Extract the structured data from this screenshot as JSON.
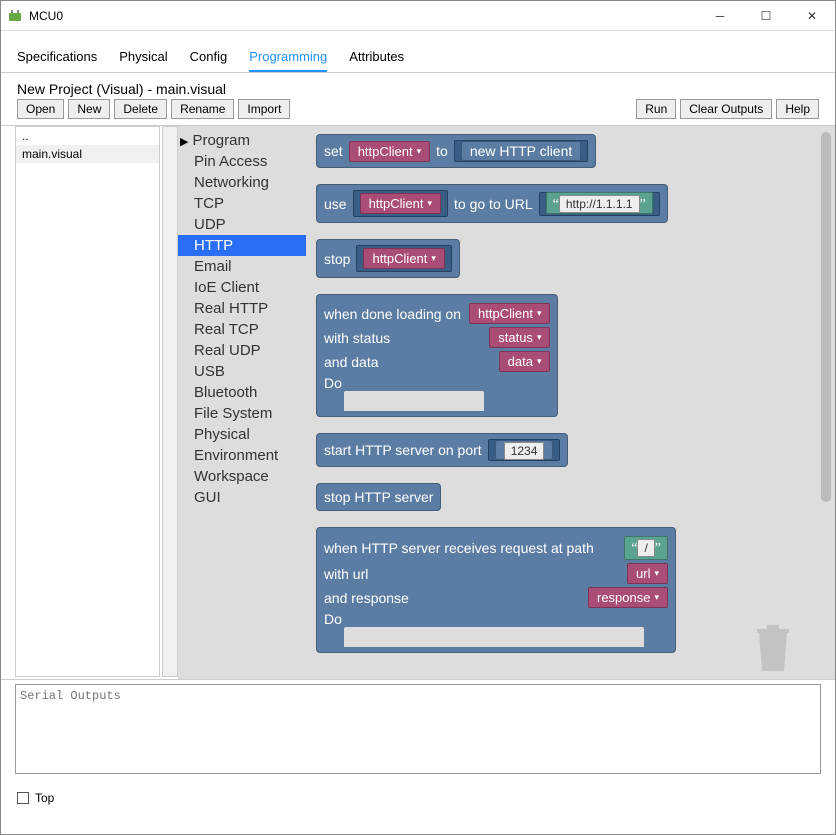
{
  "window": {
    "title": "MCU0"
  },
  "tabs": [
    "Specifications",
    "Physical",
    "Config",
    "Programming",
    "Attributes"
  ],
  "active_tab": "Programming",
  "project_title": "New Project (Visual) - main.visual",
  "toolbar_left": [
    "Open",
    "New",
    "Delete",
    "Rename",
    "Import"
  ],
  "toolbar_right": [
    "Run",
    "Clear Outputs",
    "Help"
  ],
  "filelist": [
    "..",
    "main.visual"
  ],
  "categories": [
    "Program",
    "Pin Access",
    "Networking",
    "TCP",
    "UDP",
    "HTTP",
    "Email",
    "IoE Client",
    "Real HTTP",
    "Real TCP",
    "Real UDP",
    "USB",
    "Bluetooth",
    "File System",
    "Physical",
    "Environment",
    "Workspace",
    "GUI"
  ],
  "selected_category": "HTTP",
  "blocks": {
    "set_label": "set",
    "to_label": "to",
    "new_http": "new HTTP client",
    "httpClient": "httpClient",
    "use_label": "use",
    "goto": "to go to URL",
    "url_value": "http://1.1.1.1",
    "stop_label": "stop",
    "when_done": "when done loading on",
    "with_status": "with status",
    "and_data": "and data",
    "status": "status",
    "data": "data",
    "do": "Do",
    "start_server": "start HTTP server on port",
    "port": "1234",
    "stop_server": "stop HTTP server",
    "when_receives": "when HTTP server receives request at path",
    "slash": "/",
    "with_url": "with url",
    "url": "url",
    "and_response": "and response",
    "response": "response"
  },
  "serial_placeholder": "Serial Outputs",
  "bottom_checkbox": "Top"
}
